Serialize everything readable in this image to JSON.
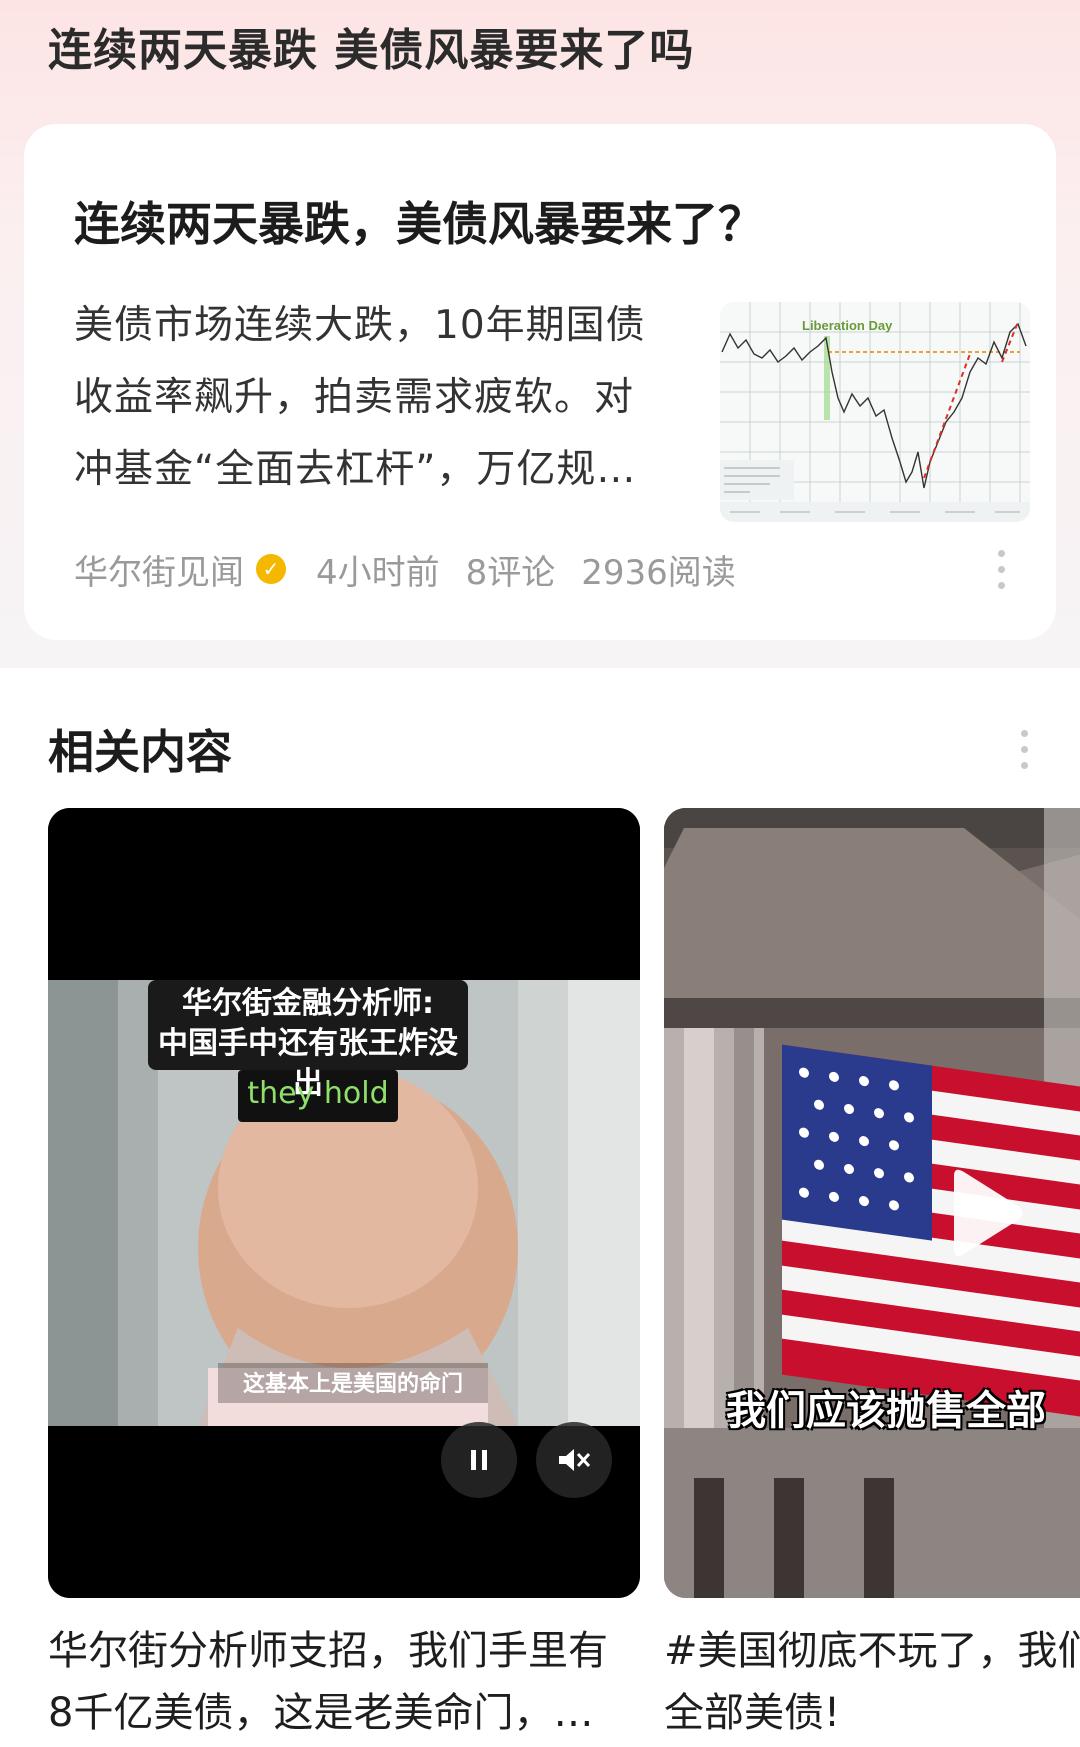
{
  "page": {
    "title": "连续两天暴跌 美债风暴要来了吗"
  },
  "article": {
    "title": "连续两天暴跌，美债风暴要来了？",
    "summary_lines": [
      "美债市场连续大跌，10年期国债",
      "收益率飙升，拍卖需求疲软。对",
      "冲基金“全面去杠杆”，万亿规…"
    ],
    "thumbnail_label": "Liberation Day",
    "source": "华尔街见闻",
    "time": "4小时前",
    "comments": "8评论",
    "reads": "2936阅读"
  },
  "related": {
    "title": "相关内容",
    "items": [
      {
        "overlay_line1": "华尔街金融分析师:",
        "overlay_line2": "中国手中还有张王炸没出",
        "subtitle_en": "they hold",
        "subtitle_zh": "这基本上是美国的命门",
        "caption_line1": "华尔街分析师支招，我们手里有",
        "caption_line2": "8千亿美债，这是老美命门，…"
      },
      {
        "overlay_text": "我们应该抛售全部",
        "caption_line1": "#美国彻底不玩了，我们",
        "caption_line2": "全部美债!"
      }
    ]
  },
  "icons": {
    "pause": "pause-icon",
    "mute": "mute-icon",
    "play": "play-icon",
    "more": "more-vertical-icon",
    "verified": "verified-badge-icon"
  },
  "colors": {
    "header_bg_top": "#fde4e4",
    "verified_badge": "#f5b800",
    "thumb_dashed_red": "#d9302a",
    "thumb_dashed_orange": "#e8a23a"
  }
}
